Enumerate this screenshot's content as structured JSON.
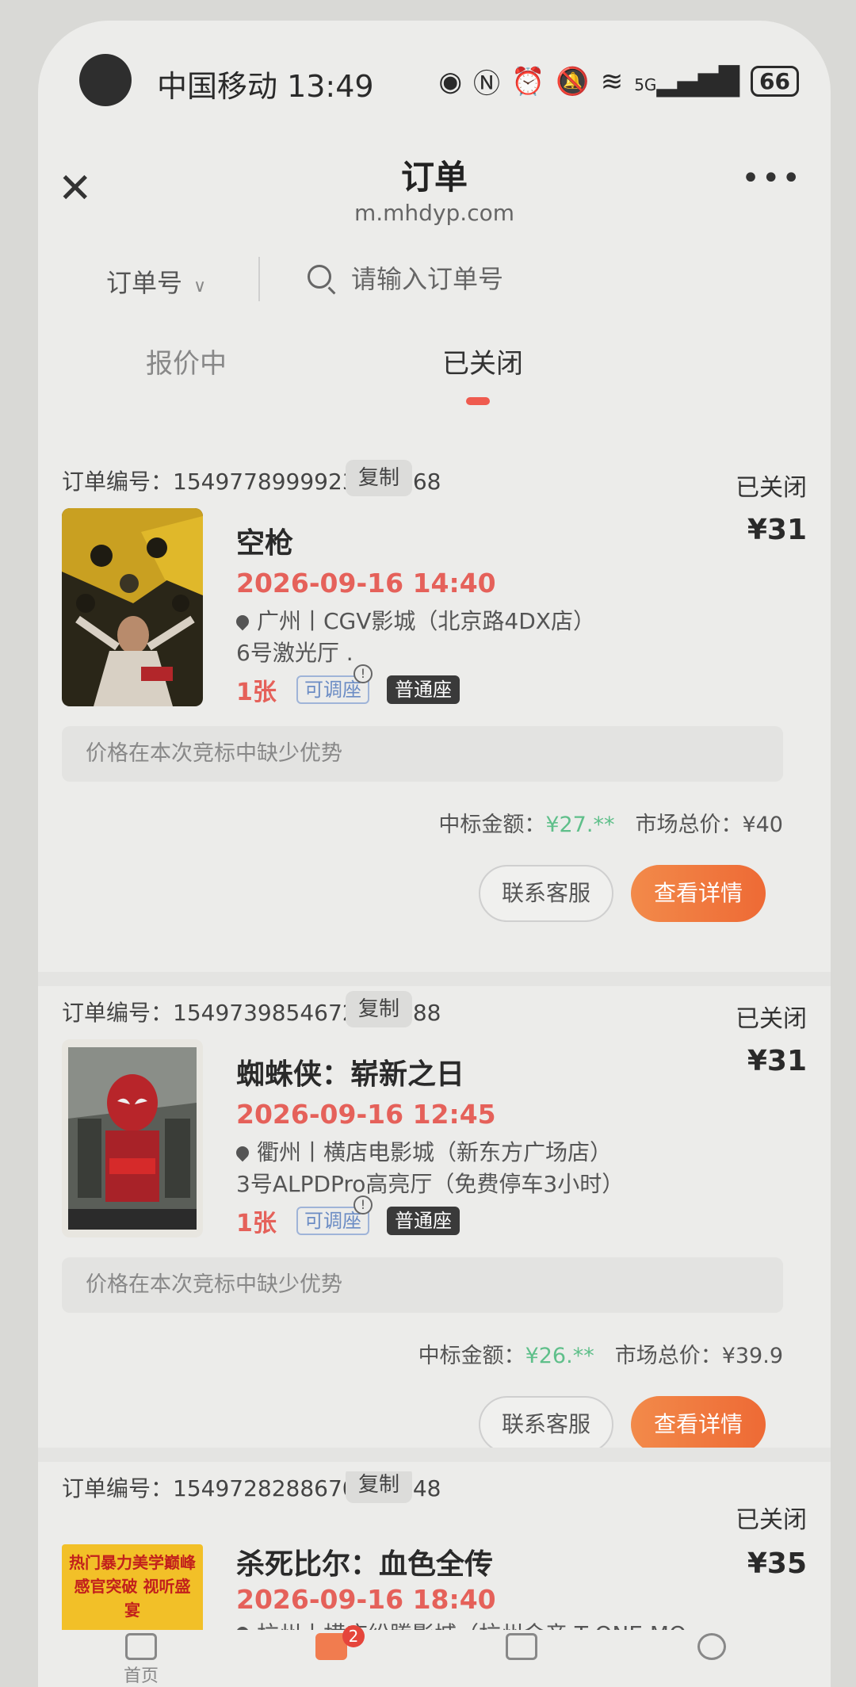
{
  "status_bar": {
    "carrier_time": "中国移动 13:49",
    "signal": "5G",
    "battery": "66"
  },
  "header": {
    "title": "订单",
    "url": "m.mhdyp.com"
  },
  "search": {
    "filter_label": "订单号",
    "placeholder": "请输入订单号"
  },
  "tabs": [
    {
      "label": "报价中"
    },
    {
      "label": "已关闭",
      "active": true
    }
  ],
  "orders": [
    {
      "order_label": "订单编号：",
      "order_no": "1549778999923847168",
      "copy_label": "复制",
      "status": "已关闭",
      "title": "空枪",
      "price": "¥31",
      "datetime": "2026-09-16 14:40",
      "location": "广州丨CGV影城（北京路4DX店）",
      "hall": "6号激光厅 .",
      "quantity": "1张",
      "tag_adjustable": "可调座",
      "tag_seat": "普通座",
      "notice": "价格在本次竞标中缺少优势",
      "win_label": "中标金额：",
      "win_amount": "¥27.**",
      "market_label": "市场总价：",
      "market_amount": "¥40",
      "btn_service": "联系客服",
      "btn_detail": "查看详情"
    },
    {
      "order_label": "订单编号：",
      "order_no": "1549739854672703488",
      "copy_label": "复制",
      "status": "已关闭",
      "title": "蜘蛛侠：崭新之日",
      "price": "¥31",
      "datetime": "2026-09-16 12:45",
      "location": "衢州丨横店电影城（新东方广场店）",
      "hall": "3号ALPDPro高亮厅（免费停车3小时）",
      "quantity": "1张",
      "tag_adjustable": "可调座",
      "tag_seat": "普通座",
      "notice": "价格在本次竞标中缺少优势",
      "win_label": "中标金额：",
      "win_amount": "¥26.**",
      "market_label": "市场总价：",
      "market_amount": "¥39.9",
      "btn_service": "联系客服",
      "btn_detail": "查看详情"
    },
    {
      "order_label": "订单编号：",
      "order_no": "1549728288670363648",
      "copy_label": "复制",
      "status": "已关闭",
      "title": "杀死比尔：血色全传",
      "price": "¥35",
      "datetime": "2026-09-16 18:40",
      "location": "杭州丨横店纷腾影城（杭州金帝 T-ONE MO",
      "poster_text": "热门暴力美学巅峰 感官突破 视听盛宴"
    }
  ],
  "bottom_nav": [
    {
      "label": "首页",
      "icon": "home-icon"
    },
    {
      "label": "",
      "icon": "orders-icon",
      "badge": "2",
      "active": true
    },
    {
      "label": "",
      "icon": "list-icon"
    },
    {
      "label": "",
      "icon": "profile-icon"
    }
  ],
  "colors": {
    "accent": "#ee6a35",
    "time_red": "#e5615a",
    "win_green": "#5fbf8a",
    "tab_indicator": "#ef5b4f"
  }
}
